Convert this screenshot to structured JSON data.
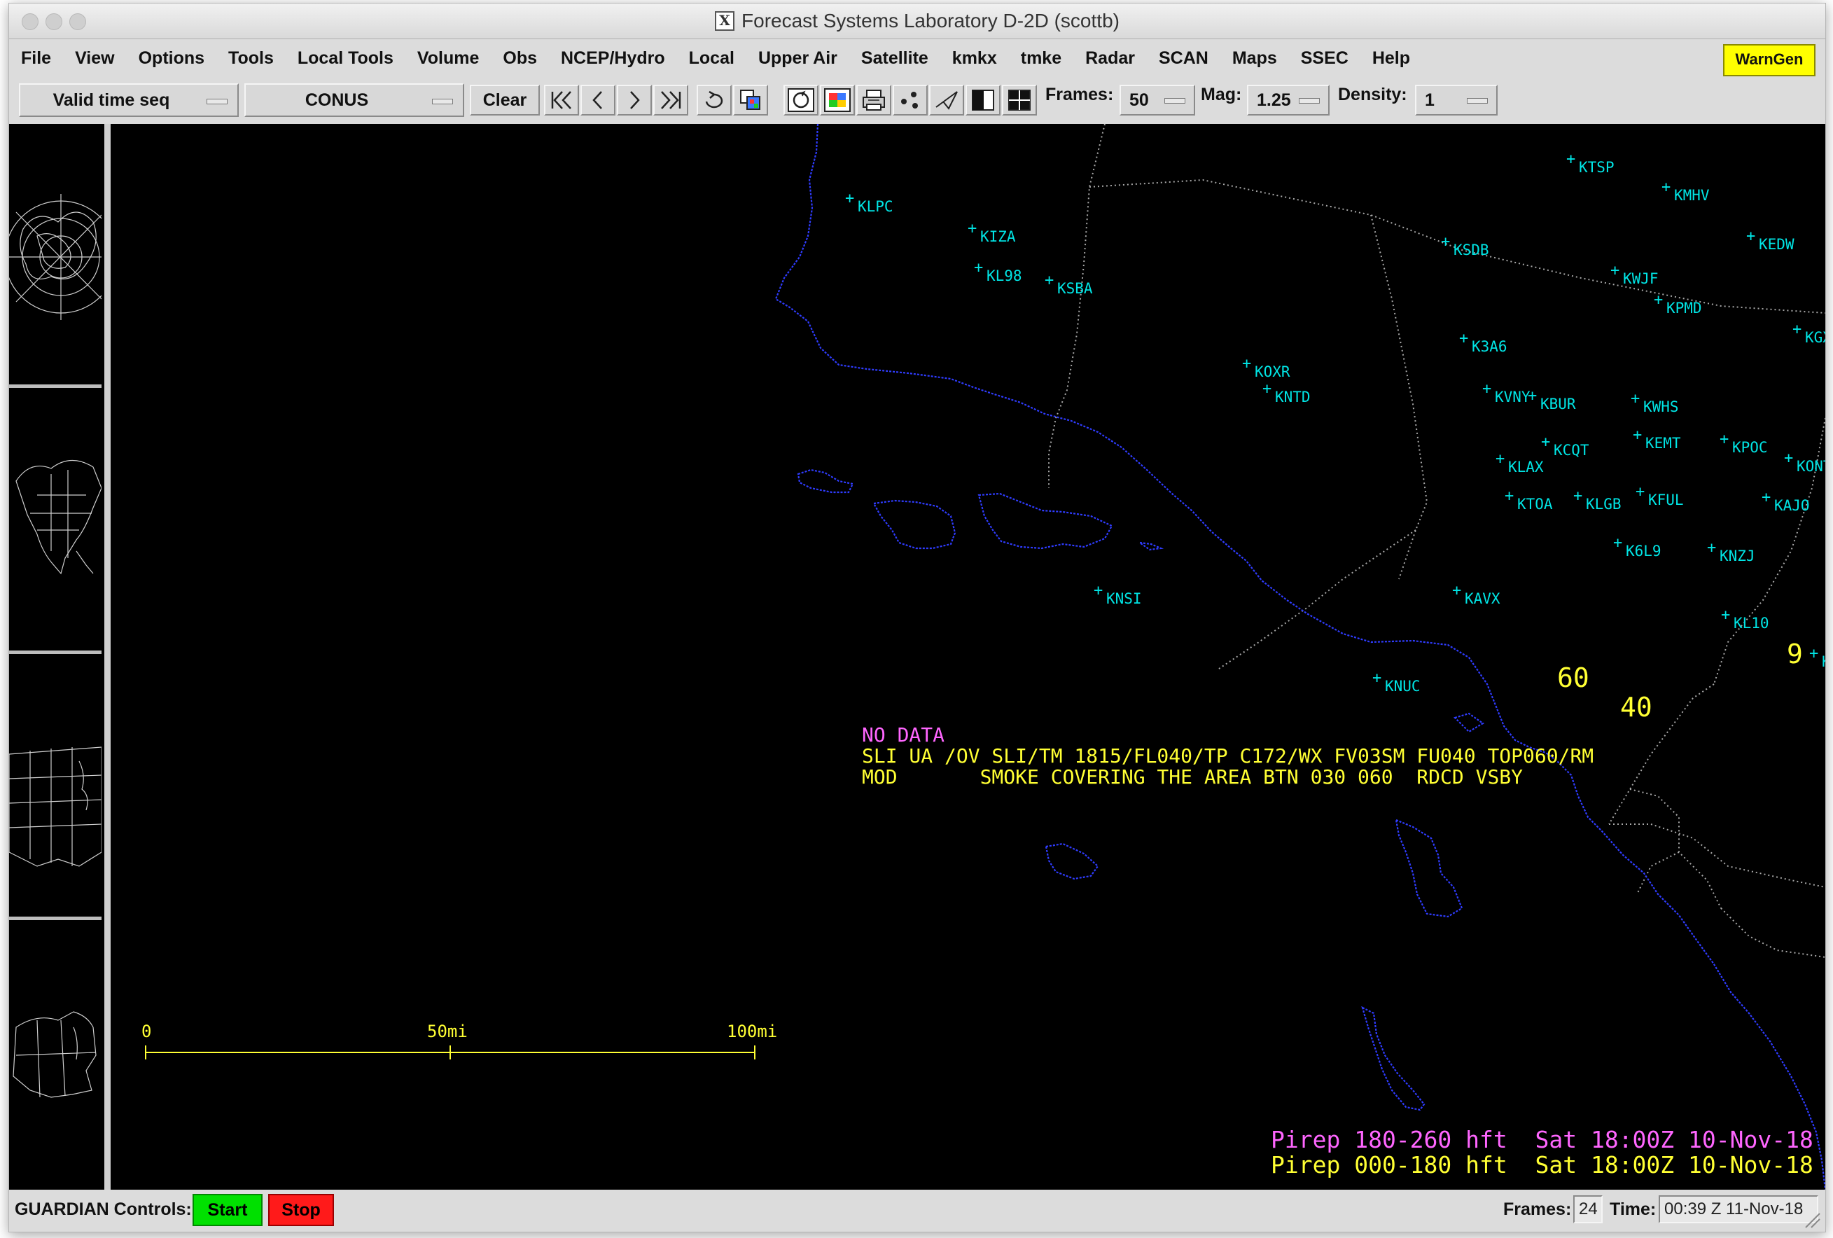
{
  "window": {
    "title": "Forecast Systems Laboratory D-2D (scottb)"
  },
  "menu": [
    "File",
    "View",
    "Options",
    "Tools",
    "Local Tools",
    "Volume",
    "Obs",
    "NCEP/Hydro",
    "Local",
    "Upper Air",
    "Satellite",
    "kmkx",
    "tmke",
    "Radar",
    "SCAN",
    "Maps",
    "SSEC",
    "Help"
  ],
  "warngen": "WarnGen",
  "toolbar": {
    "time_mode": "Valid time seq",
    "scale": "CONUS",
    "clear": "Clear",
    "frames_label": "Frames:",
    "frames_value": "50",
    "mag_label": "Mag:",
    "mag_value": "1.25",
    "density_label": "Density:",
    "density_value": "1"
  },
  "map": {
    "stations": [
      {
        "id": "KTSP"
      },
      {
        "id": "KMHV"
      },
      {
        "id": "KLPC"
      },
      {
        "id": "KIZA"
      },
      {
        "id": "KEDW"
      },
      {
        "id": "KSDB"
      },
      {
        "id": "KWJF"
      },
      {
        "id": "KL98"
      },
      {
        "id": "KSBA"
      },
      {
        "id": "KPMD"
      },
      {
        "id": "KGX"
      },
      {
        "id": "K3A6"
      },
      {
        "id": "KOXR"
      },
      {
        "id": "KVNY"
      },
      {
        "id": "KBUR"
      },
      {
        "id": "KNTD"
      },
      {
        "id": "KWHS"
      },
      {
        "id": "KEMT"
      },
      {
        "id": "KPOC"
      },
      {
        "id": "KCQT"
      },
      {
        "id": "KONT"
      },
      {
        "id": "KLAX"
      },
      {
        "id": "KTOA"
      },
      {
        "id": "KLGB"
      },
      {
        "id": "KFUL"
      },
      {
        "id": "KAJO"
      },
      {
        "id": "K6L9"
      },
      {
        "id": "KNZJ"
      },
      {
        "id": "KNSI"
      },
      {
        "id": "KAVX"
      },
      {
        "id": "KL10"
      },
      {
        "id": "KNUC"
      },
      {
        "id": "K"
      }
    ],
    "pirep_values": {
      "a": "60",
      "b": "40",
      "c": "9"
    },
    "pirep_text": {
      "line1": "NO DATA",
      "line2": "SLI UA /OV SLI/TM 1815/FL040/TP C172/WX FV03SM FU040 TOP060/RM",
      "line3": "MOD       SMOKE COVERING THE AREA BTN 030 060  RDCD VSBY"
    },
    "scale_bar": {
      "zero": "0",
      "mid": "50mi",
      "max": "100mi"
    },
    "legend": [
      {
        "text": "Pirep 180-260 hft  Sat 18:00Z 10-Nov-18",
        "color": "#ff66ff"
      },
      {
        "text": "Pirep 000-180 hft  Sat 18:00Z 10-Nov-18",
        "color": "#ffff33"
      }
    ],
    "colors": {
      "coast": "#3333ff",
      "station": "#00e5e5",
      "boundary": "#bdbdbd",
      "pirep_low": "#ffff33",
      "pirep_high": "#ff66ff"
    }
  },
  "status": {
    "guardian_label": "GUARDIAN Controls:",
    "start": "Start",
    "stop": "Stop",
    "frames_label": "Frames:",
    "frames_value": "24",
    "time_label": "Time:",
    "time_value": "00:39 Z 11-Nov-18"
  }
}
